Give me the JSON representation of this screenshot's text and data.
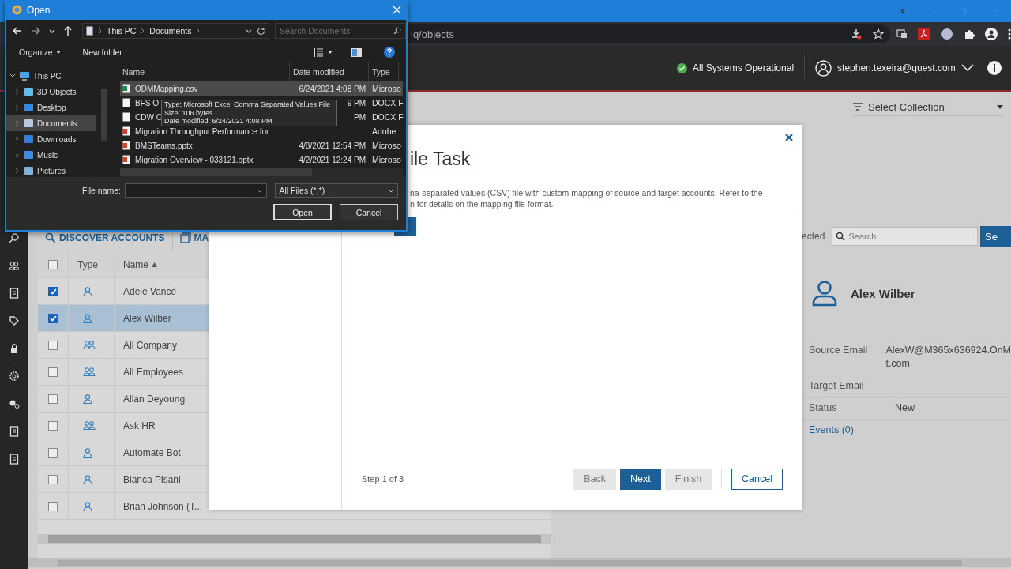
{
  "browser": {
    "url": "lq/objects"
  },
  "header": {
    "status": "All Systems Operational",
    "status_ok": true,
    "user": "stephen.texeira@quest.com"
  },
  "collection": {
    "label": "Select Collection"
  },
  "toolbar": [
    {
      "label": "DISCOVER ACCOUNTS",
      "kind": "search"
    },
    {
      "label": "MA",
      "kind": "map"
    }
  ],
  "table": {
    "select_all_checked": false,
    "columns": [
      {
        "label": "Type",
        "sorted": false
      },
      {
        "label": "Name",
        "sorted": true
      }
    ],
    "rows": [
      {
        "kind": "user",
        "name": "Adele Vance",
        "checked": true,
        "selected": false
      },
      {
        "kind": "user",
        "name": "Alex Wilber",
        "checked": true,
        "selected": true
      },
      {
        "kind": "group",
        "name": "All Company",
        "checked": false,
        "selected": false
      },
      {
        "kind": "group",
        "name": "All Employees",
        "checked": false,
        "selected": false
      },
      {
        "kind": "user",
        "name": "Allan Deyoung",
        "checked": false,
        "selected": false
      },
      {
        "kind": "group",
        "name": "Ask HR",
        "checked": false,
        "selected": false
      },
      {
        "kind": "user",
        "name": "Automate Bot",
        "checked": false,
        "selected": false
      },
      {
        "kind": "user",
        "name": "Bianca Pisani",
        "checked": false,
        "selected": false
      },
      {
        "kind": "user",
        "name": "Brian Johnson (T...",
        "checked": false,
        "selected": false
      }
    ]
  },
  "details": {
    "selected_label": "ected",
    "search": {
      "placeholder": "Search"
    },
    "search_button": "Se",
    "name": "Alex Wilber",
    "fields": [
      {
        "label": "Source Email",
        "lines": [
          "AlexW@M365x636924.OnM",
          "t.com"
        ]
      },
      {
        "label": "Target Email"
      },
      {
        "label": "Status",
        "lines": [
          "New"
        ]
      }
    ],
    "events_link": "Events (0)"
  },
  "modal": {
    "title": "ile Task",
    "description": [
      "na-separated values (CSV) file with custom mapping of source and target accounts. Refer to the",
      "n for details on the mapping file format."
    ],
    "step": "Step 1 of 3",
    "buttons": [
      {
        "label": "Back",
        "kind": "secondary",
        "disabled": true
      },
      {
        "label": "Next",
        "kind": "primary",
        "disabled": false
      },
      {
        "label": "Finish",
        "kind": "secondary",
        "disabled": true
      },
      {
        "label": "Cancel",
        "kind": "outline",
        "disabled": false
      }
    ]
  },
  "open_dialog": {
    "title": "Open",
    "path": [
      "This PC",
      "Documents"
    ],
    "search": {
      "placeholder": "Search Documents"
    },
    "commands": [
      "Organize",
      "New folder"
    ],
    "tree": [
      {
        "label": "This PC",
        "kind": "pc",
        "expanded": true,
        "selected": false,
        "children": [
          {
            "label": "3D Objects",
            "kind": "objects",
            "expanded": false,
            "selected": false
          },
          {
            "label": "Desktop",
            "kind": "desktop",
            "expanded": false,
            "selected": false
          },
          {
            "label": "Documents",
            "kind": "documents",
            "expanded": false,
            "selected": true
          },
          {
            "label": "Downloads",
            "kind": "downloads",
            "expanded": false,
            "selected": false
          },
          {
            "label": "Music",
            "kind": "music",
            "expanded": false,
            "selected": false
          },
          {
            "label": "Pictures",
            "kind": "pictures",
            "expanded": false,
            "selected": false
          }
        ]
      }
    ],
    "columns": [
      "Name",
      "Date modified",
      "Type"
    ],
    "files": [
      {
        "kind": "csv",
        "name": "ODMMapping.csv",
        "date": "6/24/2021 4:08 PM",
        "type": "Microso",
        "selected": true
      },
      {
        "kind": "doc",
        "name": "BFS Q",
        "date": "9 PM",
        "type": "DOCX F",
        "selected": false
      },
      {
        "kind": "doc",
        "name": "CDW C",
        "date": "PM",
        "type": "DOCX F",
        "selected": false
      },
      {
        "kind": "pdf",
        "name": "Migration Throughput Performance for",
        "type": "Adobe",
        "selected": false
      },
      {
        "kind": "pptx",
        "name": "BMSTeams.pptx",
        "date": "4/8/2021 12:54 PM",
        "type": "Microso",
        "selected": false
      },
      {
        "kind": "pptx",
        "name": "Migration Overview - 033121.pptx",
        "date": "4/2/2021 12:24 PM",
        "type": "Microso",
        "selected": false
      }
    ],
    "tooltip": [
      "Type: Microsoft Excel Comma Separated Values File",
      "Size: 106 bytes",
      "Date modified: 6/24/2021 4:08 PM"
    ],
    "file_name_label": "File name:",
    "filter": "All Files (*.*)",
    "buttons": [
      "Open",
      "Cancel"
    ]
  }
}
